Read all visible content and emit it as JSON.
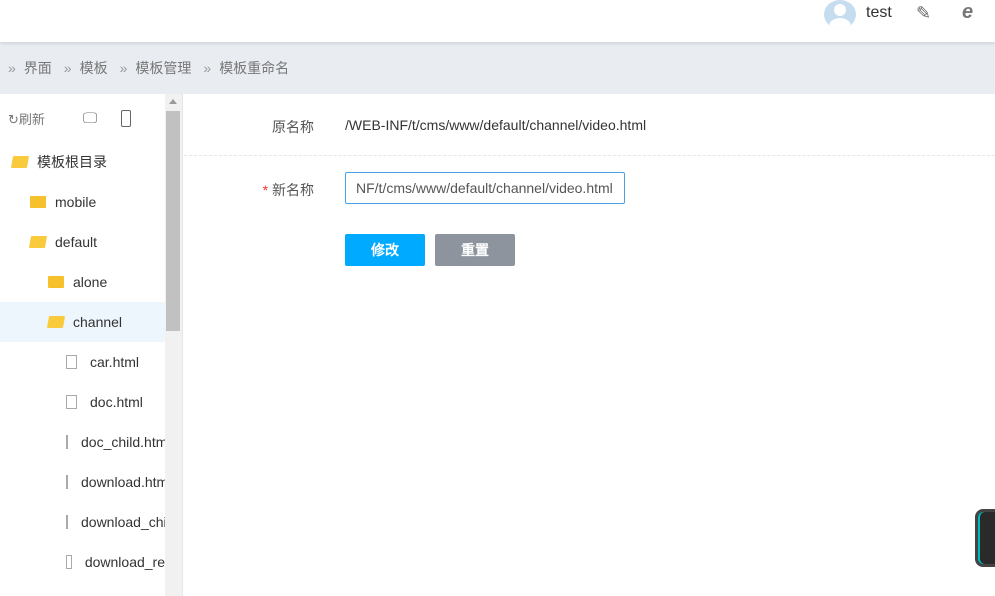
{
  "header": {
    "username": "test",
    "icons": [
      "user-avatar",
      "user-edit-icon",
      "ie-browser-icon"
    ]
  },
  "breadcrumb": [
    "界面",
    "模板",
    "模板管理",
    "模板重命名"
  ],
  "sidebar": {
    "refresh_label": "刷新",
    "tree": [
      {
        "label": "模板根目录",
        "type": "folder-open",
        "level": 0
      },
      {
        "label": "mobile",
        "type": "folder",
        "level": 1
      },
      {
        "label": "default",
        "type": "folder-open",
        "level": 1
      },
      {
        "label": "alone",
        "type": "folder",
        "level": 2
      },
      {
        "label": "channel",
        "type": "folder-open",
        "level": 2,
        "selected": true
      },
      {
        "label": "car.html",
        "type": "file",
        "level": 3
      },
      {
        "label": "doc.html",
        "type": "file",
        "level": 3
      },
      {
        "label": "doc_child.html",
        "type": "file",
        "level": 3
      },
      {
        "label": "download.html",
        "type": "file",
        "level": 3
      },
      {
        "label": "download_child.html",
        "type": "file",
        "level": 3
      },
      {
        "label": "download_re",
        "type": "file",
        "level": 3
      }
    ]
  },
  "form": {
    "old_name_label": "原名称",
    "old_name_value": "/WEB-INF/t/cms/www/default/channel/video.html",
    "required_mark": "*",
    "new_name_label": "新名称",
    "new_name_value": "NF/t/cms/www/default/channel/video.html",
    "submit_label": "修改",
    "reset_label": "重置"
  },
  "colors": {
    "primary": "#00aaff",
    "reset": "#8d949e"
  }
}
